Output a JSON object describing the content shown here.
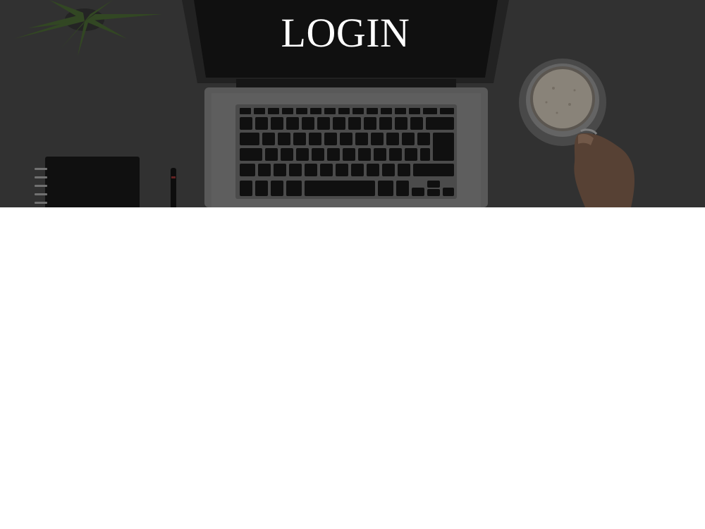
{
  "hero": {
    "title": "LOGIN",
    "background_alt": "desk-with-laptop-photo"
  },
  "colors": {
    "overlay": "#3b3b3b",
    "title_text": "#ffffff",
    "page_background": "#ffffff"
  }
}
